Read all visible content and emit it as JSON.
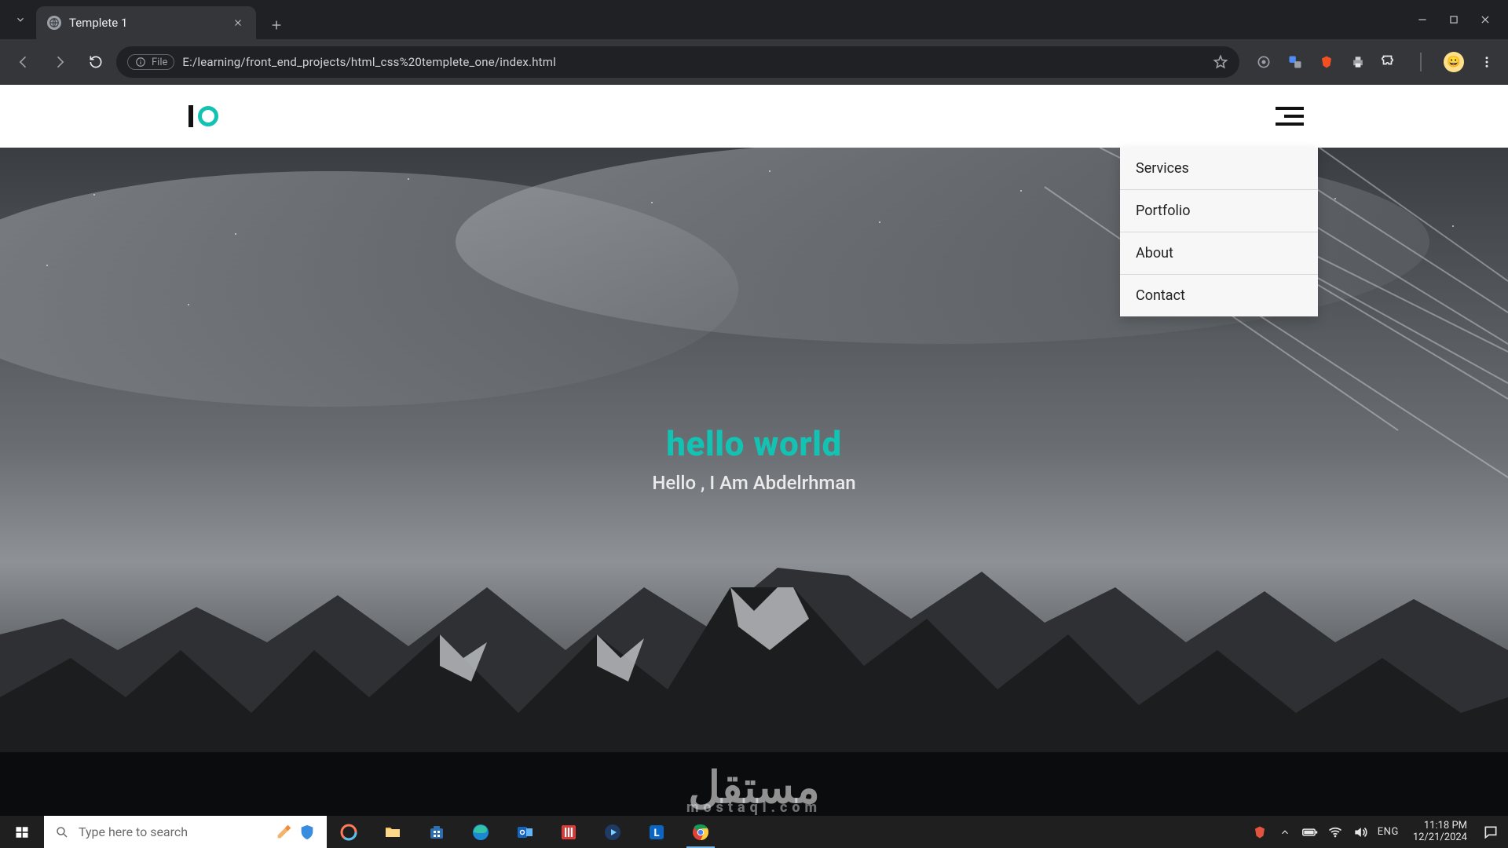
{
  "browser": {
    "tab_title": "Templete 1",
    "file_chip": "File",
    "url": "E:/learning/front_end_projects/html_css%20templete_one/index.html"
  },
  "site": {
    "dropdown": [
      "Services",
      "Portfolio",
      "About",
      "Contact"
    ],
    "hero_title": "hello world",
    "hero_sub": "Hello , I Am Abdelrhman",
    "watermark_main": "مستقل",
    "watermark_sub": "mostaql.com"
  },
  "taskbar": {
    "search_placeholder": "Type here to search",
    "lang": "ENG",
    "time": "11:18 PM",
    "date": "12/21/2024"
  }
}
